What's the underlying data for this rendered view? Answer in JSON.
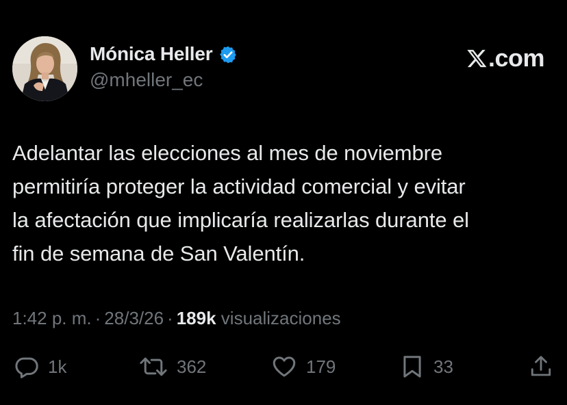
{
  "author": {
    "display_name": "Mónica Heller",
    "handle": "@mheller_ec",
    "verified_badge_icon": "verified-badge-icon",
    "verified_color": "#1d9bf0"
  },
  "brand": {
    "logo_icon": "x-logo-icon",
    "suffix": ".com"
  },
  "post": {
    "text": "Adelantar las elecciones al mes de noviembre\npermitiría proteger la actividad comercial y evitar\nla afectación que implicaría realizarlas durante el\nfin de semana de San Valentín."
  },
  "meta": {
    "time": "1:42 p. m.",
    "separator": "·",
    "date": "28/3/26",
    "views_count": "189k",
    "views_label": "visualizaciones"
  },
  "actions": {
    "reply": {
      "icon": "reply-icon",
      "count": "1k"
    },
    "repost": {
      "icon": "repost-icon",
      "count": "362"
    },
    "like": {
      "icon": "heart-icon",
      "count": "179"
    },
    "bookmark": {
      "icon": "bookmark-icon",
      "count": "33"
    },
    "share": {
      "icon": "share-icon"
    }
  },
  "colors": {
    "background": "#000000",
    "primary_text": "#e7e9ea",
    "secondary_text": "#71767b"
  }
}
